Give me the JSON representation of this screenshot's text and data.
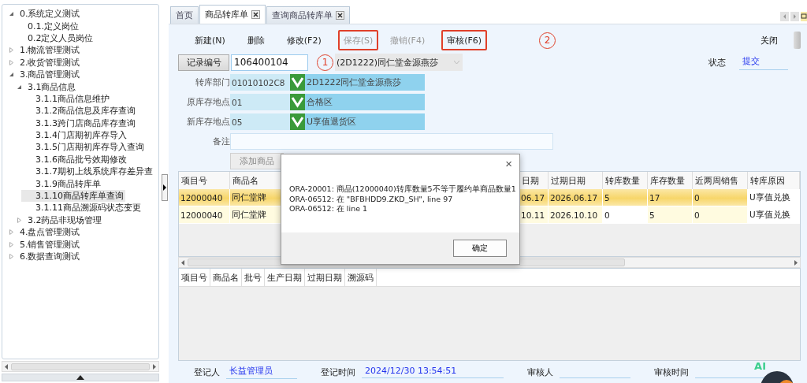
{
  "sidebar": {
    "tree": [
      {
        "label": "0.系统定义测试",
        "expanded": true,
        "selected": false,
        "children": [
          {
            "label": "0.1.定义岗位",
            "selected": false
          },
          {
            "label": "0.2定义人员岗位",
            "selected": false
          }
        ]
      },
      {
        "label": "1.物流管理测试",
        "expanded": false,
        "selected": false
      },
      {
        "label": "2.收货管理测试",
        "expanded": false,
        "selected": false
      },
      {
        "label": "3.商品管理测试",
        "expanded": true,
        "selected": false,
        "children": [
          {
            "label": "3.1商品信息",
            "expanded": true,
            "selected": false,
            "children": [
              {
                "label": "3.1.1商品信息维护",
                "selected": false
              },
              {
                "label": "3.1.2商品信息及库存查询",
                "selected": false
              },
              {
                "label": "3.1.3跨门店商品库存查询",
                "selected": false
              },
              {
                "label": "3.1.4门店期初库存导入",
                "selected": false
              },
              {
                "label": "3.1.5门店期初库存导入查询",
                "selected": false
              },
              {
                "label": "3.1.6商品批号效期修改",
                "selected": false
              },
              {
                "label": "3.1.7期初上线系统库存差异查",
                "selected": false
              },
              {
                "label": "3.1.9商品转库单",
                "selected": false
              },
              {
                "label": "3.1.10商品转库单查询",
                "selected": true
              },
              {
                "label": "3.1.11商品溯源码状态变更",
                "selected": false
              }
            ]
          },
          {
            "label": "3.2药品非现场管理",
            "expanded": false,
            "selected": false
          }
        ]
      },
      {
        "label": "4.盘点管理测试",
        "expanded": false,
        "selected": false
      },
      {
        "label": "5.销售管理测试",
        "expanded": false,
        "selected": false
      },
      {
        "label": "6.数据查询测试",
        "expanded": false,
        "selected": false
      }
    ]
  },
  "tabs": [
    {
      "label": "首页",
      "selected": false,
      "closable": false
    },
    {
      "label": "商品转库单",
      "selected": true,
      "closable": true
    },
    {
      "label": "查询商品转库单",
      "selected": false,
      "closable": true
    }
  ],
  "toolbar": {
    "buttons": [
      {
        "label": "新建(N)",
        "disabled": false,
        "highlighted": false
      },
      {
        "label": "删除",
        "disabled": false,
        "highlighted": false
      },
      {
        "label": "修改(F2)",
        "disabled": false,
        "highlighted": false
      },
      {
        "label": "保存(S)",
        "disabled": true,
        "highlighted": true
      },
      {
        "label": "撤销(F4)",
        "disabled": true,
        "highlighted": false
      },
      {
        "label": "审核(F6)",
        "disabled": false,
        "highlighted": true
      }
    ],
    "marker": "2",
    "close": "关闭"
  },
  "record": {
    "label": "记录编号",
    "value": "106400104",
    "marker": "1",
    "store": "(2D1222)同仁堂金源燕莎"
  },
  "status": {
    "label": "状态",
    "value": "提交"
  },
  "fields": [
    {
      "label": "转库部门",
      "code": "01010102C8",
      "name": "2D1222同仁堂金源燕莎"
    },
    {
      "label": "原库存地点",
      "code": "01",
      "name": "合格区"
    },
    {
      "label": "新库存地点",
      "code": "05",
      "name": "U享值退货区"
    }
  ],
  "remark": {
    "label": "备注"
  },
  "add_button": "添加商品",
  "grid": {
    "columns": [
      "项目号",
      "商品名",
      "日期",
      "过期日期",
      "转库数量",
      "库存数量",
      "近两周销售",
      "转库原因"
    ],
    "rows": [
      {
        "selected": true,
        "cells": [
          "12000040",
          "同仁堂牌",
          "06.17",
          "2026.06.17",
          "5",
          "17",
          "0",
          "U享值兑换"
        ]
      },
      {
        "selected": false,
        "cells": [
          "12000040",
          "同仁堂牌",
          "10.11",
          "2026.10.10",
          "0",
          "5",
          "0",
          "U享值兑换"
        ]
      }
    ]
  },
  "detail_grid": {
    "columns": [
      "项目号",
      "商品名",
      "批号",
      "生产日期",
      "过期日期",
      "溯源码"
    ]
  },
  "dialog": {
    "lines": [
      "ORA-20001: 商品(12000040)转库数量5不等于履约单商品数量1",
      "ORA-06512: 在 \"BFBHDD9.ZKD_SH\", line 97",
      "ORA-06512: 在 line 1"
    ],
    "ok": "确定",
    "close": "×"
  },
  "footer": [
    {
      "label": "登记人",
      "value": "长益管理员"
    },
    {
      "label": "登记时间",
      "value": "2024/12/30 13:54:51"
    },
    {
      "label": "审核人"
    },
    {
      "label": "审核时间"
    }
  ],
  "ai_badge": "AI"
}
